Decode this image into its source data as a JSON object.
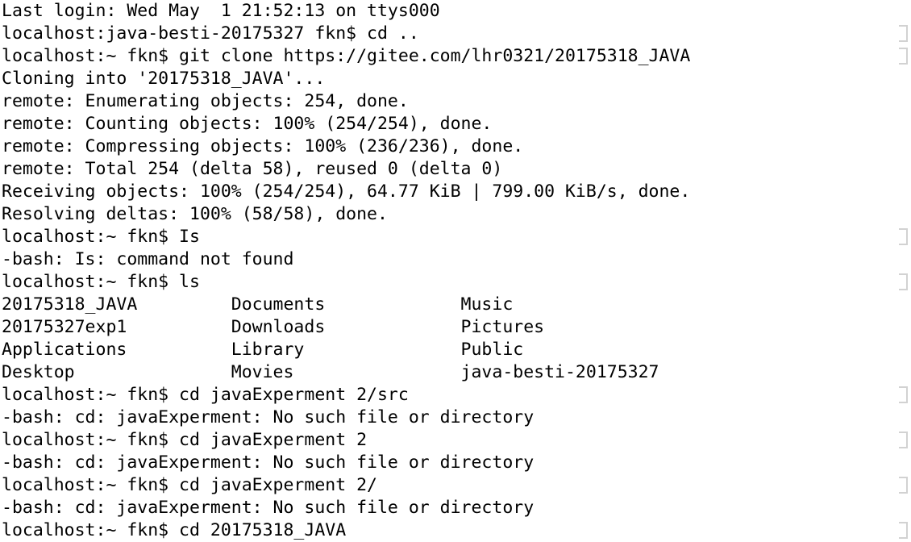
{
  "window": {
    "title": "Terminal",
    "background_color": "#ffffff",
    "foreground_color": "#000000",
    "marker_color": "#d2d2d2"
  },
  "terminal": {
    "last_login": "Last login: Wed May  1 21:52:13 on ttys000",
    "prompts": {
      "host_project": "localhost:java-besti-20175327 fkn$ ",
      "host_home": "localhost:~ fkn$ "
    },
    "lines": [
      {
        "id": "line-01",
        "kind": "output",
        "text": "Last login: Wed May  1 21:52:13 on ttys000",
        "marker": false
      },
      {
        "id": "line-02",
        "kind": "prompt",
        "text": "localhost:java-besti-20175327 fkn$ cd ..",
        "marker": true
      },
      {
        "id": "line-03",
        "kind": "prompt",
        "text": "localhost:~ fkn$ git clone https://gitee.com/lhr0321/20175318_JAVA",
        "marker": true
      },
      {
        "id": "line-04",
        "kind": "output",
        "text": "Cloning into '20175318_JAVA'...",
        "marker": false
      },
      {
        "id": "line-05",
        "kind": "output",
        "text": "remote: Enumerating objects: 254, done.",
        "marker": false
      },
      {
        "id": "line-06",
        "kind": "output",
        "text": "remote: Counting objects: 100% (254/254), done.",
        "marker": false
      },
      {
        "id": "line-07",
        "kind": "output",
        "text": "remote: Compressing objects: 100% (236/236), done.",
        "marker": false
      },
      {
        "id": "line-08",
        "kind": "output",
        "text": "remote: Total 254 (delta 58), reused 0 (delta 0)",
        "marker": false
      },
      {
        "id": "line-09",
        "kind": "output",
        "text": "Receiving objects: 100% (254/254), 64.77 KiB | 799.00 KiB/s, done.",
        "marker": false
      },
      {
        "id": "line-10",
        "kind": "output",
        "text": "Resolving deltas: 100% (58/58), done.",
        "marker": false
      },
      {
        "id": "line-11",
        "kind": "prompt",
        "text": "localhost:~ fkn$ Is",
        "marker": true
      },
      {
        "id": "line-12",
        "kind": "error",
        "text": "-bash: Is: command not found",
        "marker": false
      },
      {
        "id": "line-13",
        "kind": "prompt",
        "text": "localhost:~ fkn$ ls",
        "marker": true
      },
      {
        "id": "line-14",
        "kind": "ls-row",
        "text": "20175318_JAVA         Documents             Music",
        "marker": false
      },
      {
        "id": "line-15",
        "kind": "ls-row",
        "text": "20175327exp1          Downloads             Pictures",
        "marker": false
      },
      {
        "id": "line-16",
        "kind": "ls-row",
        "text": "Applications          Library               Public",
        "marker": false
      },
      {
        "id": "line-17",
        "kind": "ls-row",
        "text": "Desktop               Movies                java-besti-20175327",
        "marker": false
      },
      {
        "id": "line-18",
        "kind": "prompt",
        "text": "localhost:~ fkn$ cd javaExperment 2/src",
        "marker": true
      },
      {
        "id": "line-19",
        "kind": "error",
        "text": "-bash: cd: javaExperment: No such file or directory",
        "marker": false
      },
      {
        "id": "line-20",
        "kind": "prompt",
        "text": "localhost:~ fkn$ cd javaExperment 2",
        "marker": true
      },
      {
        "id": "line-21",
        "kind": "error",
        "text": "-bash: cd: javaExperment: No such file or directory",
        "marker": false
      },
      {
        "id": "line-22",
        "kind": "prompt",
        "text": "localhost:~ fkn$ cd javaExperment 2/",
        "marker": true
      },
      {
        "id": "line-23",
        "kind": "error",
        "text": "-bash: cd: javaExperment: No such file or directory",
        "marker": false
      },
      {
        "id": "line-24",
        "kind": "prompt",
        "text": "localhost:~ fkn$ cd 20175318_JAVA",
        "marker": true
      }
    ],
    "ls_output": {
      "columns": [
        [
          "20175318_JAVA",
          "20175327exp1",
          "Applications",
          "Desktop"
        ],
        [
          "Documents",
          "Downloads",
          "Library",
          "Movies"
        ],
        [
          "Music",
          "Pictures",
          "Public",
          "java-besti-20175327"
        ]
      ]
    },
    "commands_entered": [
      "cd ..",
      "git clone https://gitee.com/lhr0321/20175318_JAVA",
      "Is",
      "ls",
      "cd javaExperment 2/src",
      "cd javaExperment 2",
      "cd javaExperment 2/",
      "cd 20175318_JAVA"
    ],
    "clone_stats": {
      "repository": "20175318_JAVA",
      "remote_url": "https://gitee.com/lhr0321/20175318_JAVA",
      "enumerating_objects": "254",
      "counting_objects_pct": "100%",
      "counting_objects": "254/254",
      "compressing_objects_pct": "100%",
      "compressing_objects": "236/236",
      "total_objects": "254",
      "delta": "58",
      "reused": "0",
      "reused_delta": "0",
      "receiving_pct": "100%",
      "receiving_objects": "254/254",
      "received_size": "64.77 KiB",
      "transfer_rate": "799.00 KiB/s",
      "resolving_pct": "100%",
      "resolving_deltas": "58/58"
    }
  }
}
